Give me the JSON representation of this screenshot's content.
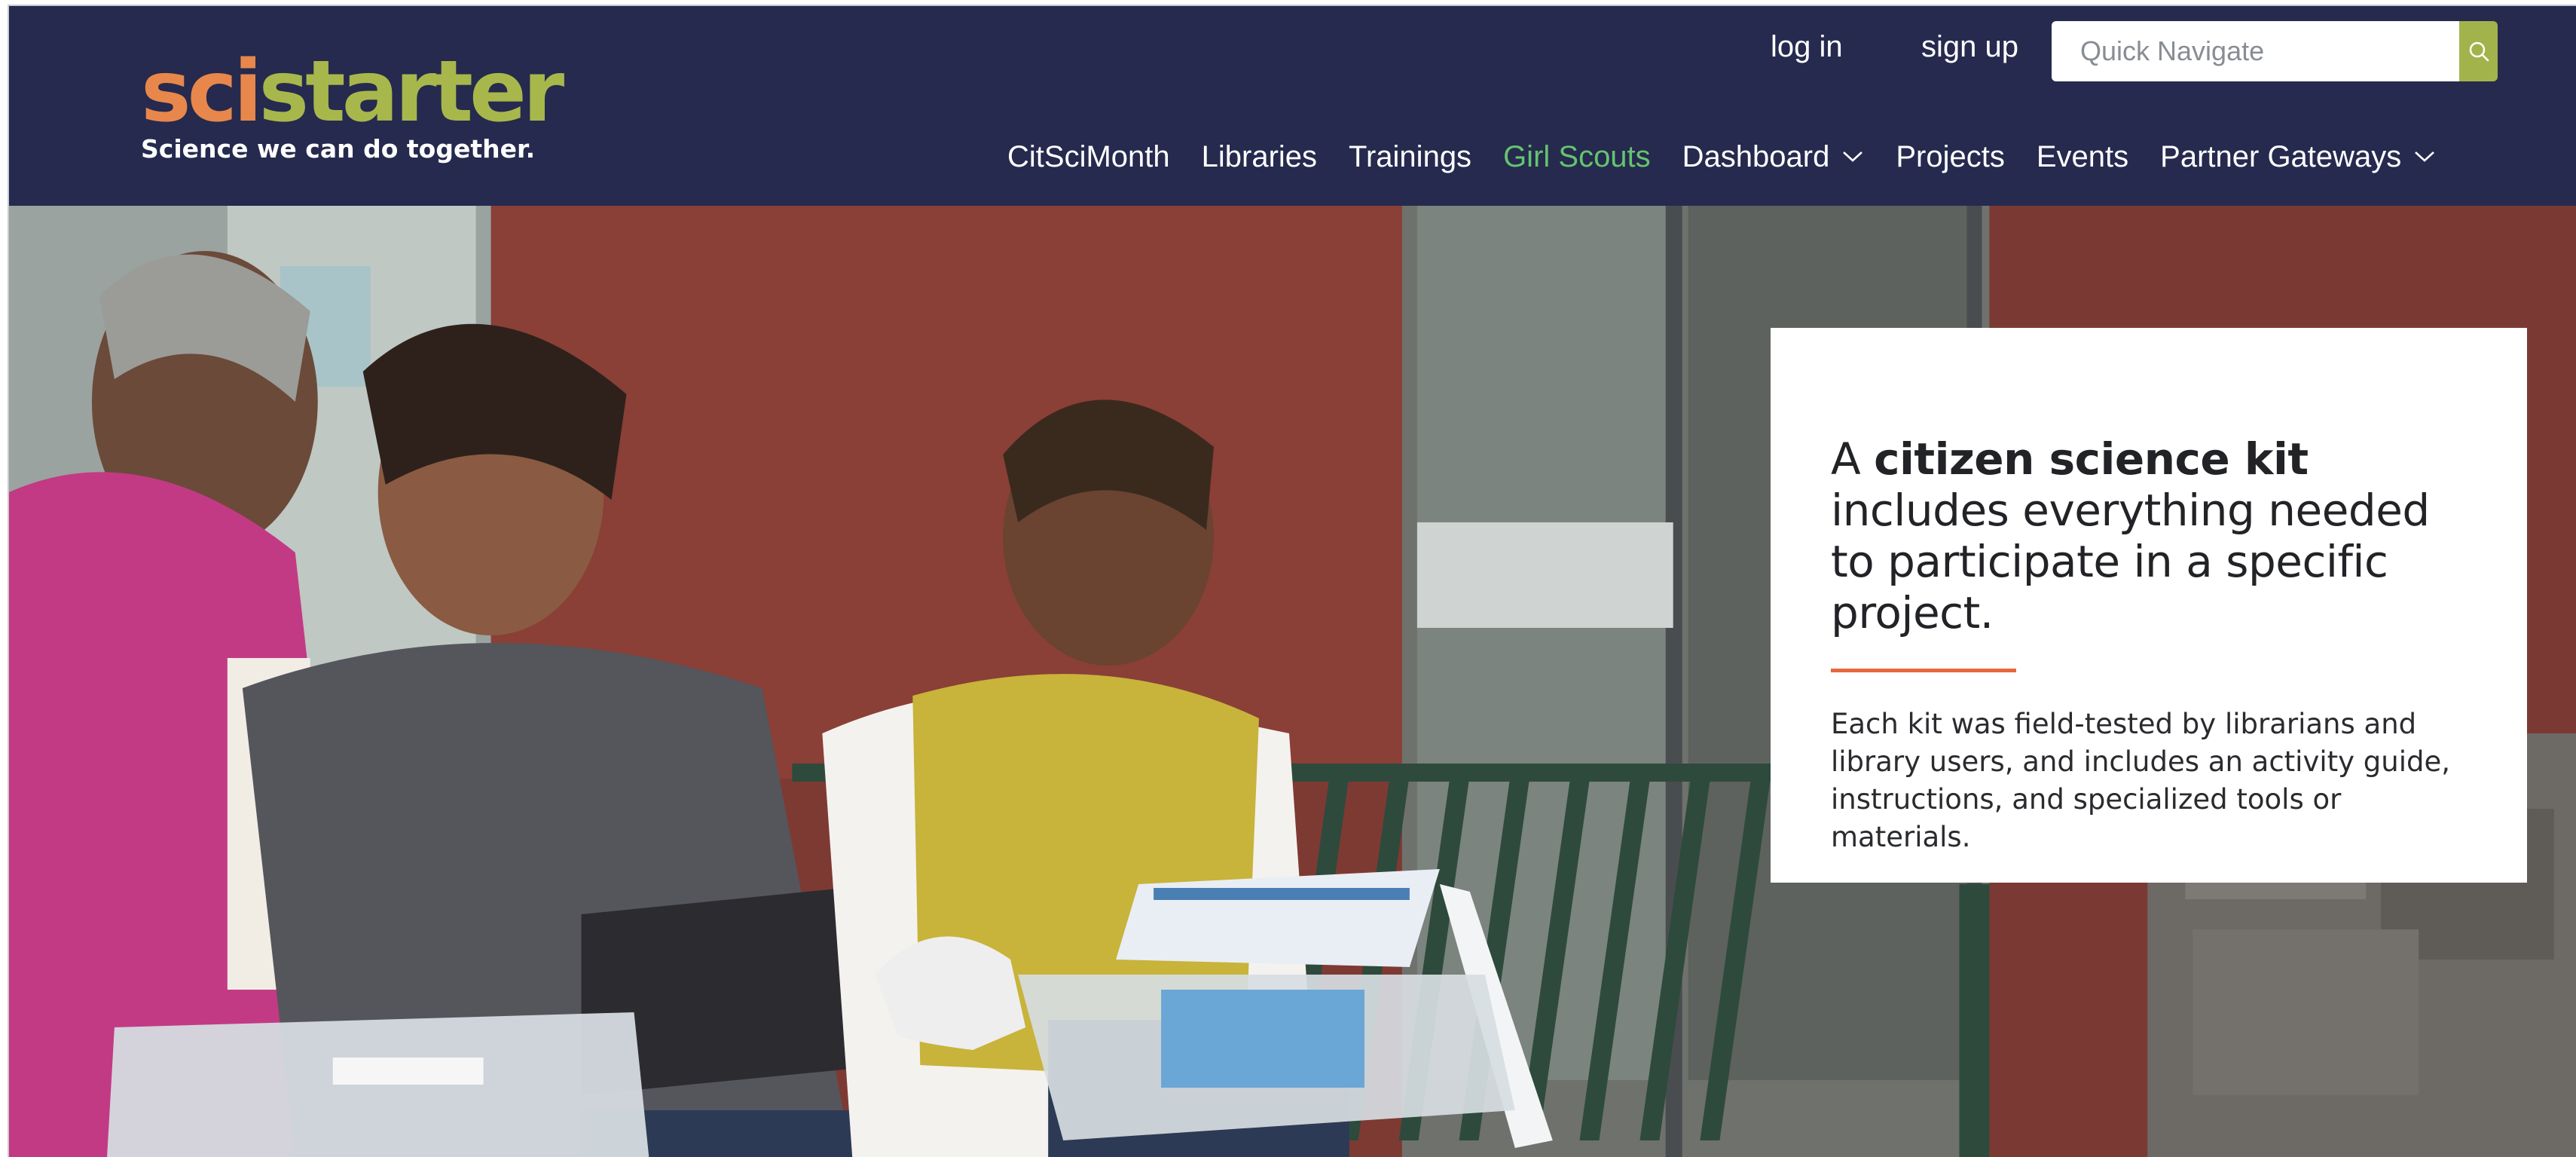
{
  "logo": {
    "sci": "sci",
    "starter": "starter",
    "tagline": "Science we can do together."
  },
  "auth": {
    "login": "log in",
    "signup": "sign up"
  },
  "search": {
    "placeholder": "Quick Navigate",
    "icon": "search-icon"
  },
  "nav": {
    "items": [
      {
        "label": "CitSciMonth"
      },
      {
        "label": "Libraries"
      },
      {
        "label": "Trainings"
      },
      {
        "label": "Girl Scouts",
        "active": true
      },
      {
        "label": "Dashboard",
        "dropdown": true
      },
      {
        "label": "Projects"
      },
      {
        "label": "Events"
      },
      {
        "label": "Partner Gateways",
        "dropdown": true
      }
    ]
  },
  "hero": {
    "headline_pre": "A ",
    "headline_bold": "citizen science kit",
    "headline_post": " includes everything needed to participate in a specific project.",
    "body": "Each kit was field-tested by librarians and library users, and includes an activity guide, instructions, and specialized tools or materials."
  },
  "colors": {
    "header_bg": "#252a4e",
    "logo_orange": "#e8874b",
    "logo_green": "#a8b74b",
    "nav_active": "#65c36f",
    "search_button": "#a3b34b",
    "accent_rule": "#e5683a"
  }
}
